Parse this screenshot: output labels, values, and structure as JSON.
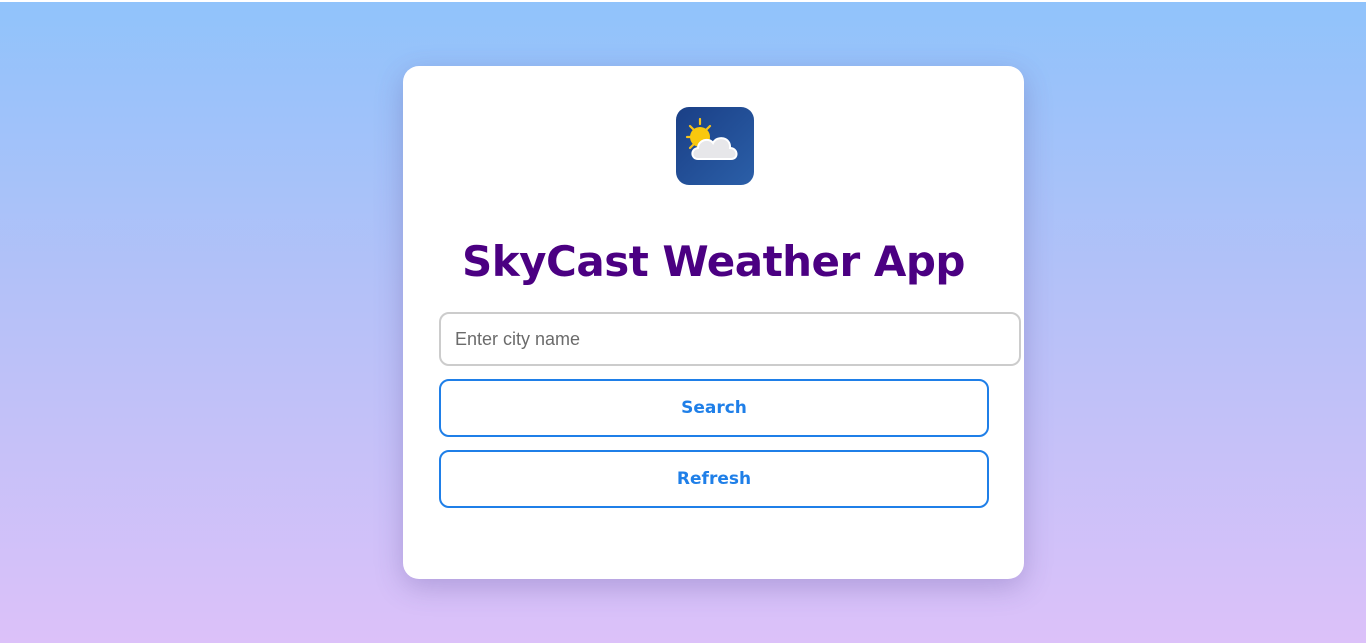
{
  "app": {
    "title": "SkyCast Weather App",
    "logo_icon": "weather-sun-cloud-icon"
  },
  "search": {
    "placeholder": "Enter city name",
    "value": ""
  },
  "buttons": {
    "search_label": "Search",
    "refresh_label": "Refresh"
  },
  "colors": {
    "title": "#4b0082",
    "accent": "#1f7fe8",
    "background_top": "#90c3fb",
    "background_bottom": "#dcc1f9"
  }
}
